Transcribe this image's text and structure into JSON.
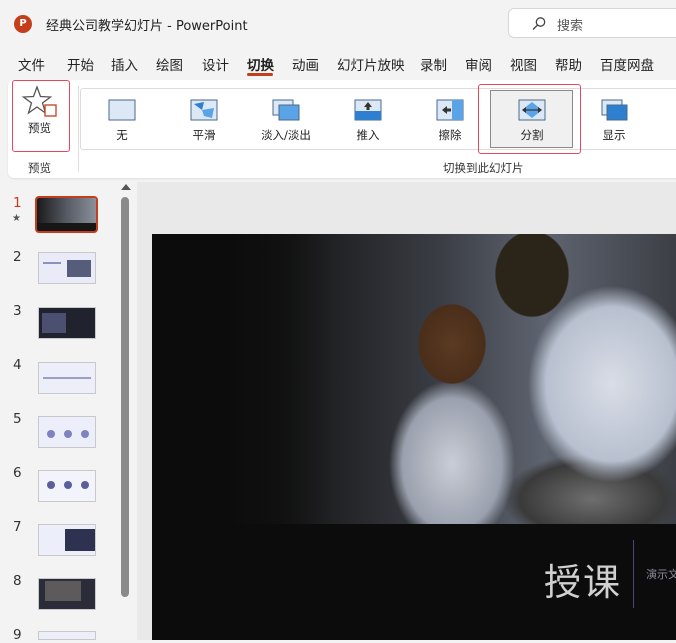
{
  "app": {
    "logo_letter": "P",
    "title": "经典公司教学幻灯片  -  PowerPoint"
  },
  "search": {
    "placeholder": "搜索"
  },
  "menu": [
    "文件",
    "开始",
    "插入",
    "绘图",
    "设计",
    "切换",
    "动画",
    "幻灯片放映",
    "录制",
    "审阅",
    "视图",
    "帮助",
    "百度网盘"
  ],
  "active_tab": "切换",
  "ribbon": {
    "preview": {
      "button_label": "预览",
      "group_label": "预览"
    },
    "transitions": {
      "items": [
        {
          "label": "无",
          "icon": "none-transition-icon"
        },
        {
          "label": "平滑",
          "icon": "morph-transition-icon"
        },
        {
          "label": "淡入/淡出",
          "icon": "fade-transition-icon"
        },
        {
          "label": "推入",
          "icon": "push-transition-icon"
        },
        {
          "label": "擦除",
          "icon": "wipe-transition-icon"
        },
        {
          "label": "分割",
          "icon": "split-transition-icon"
        },
        {
          "label": "显示",
          "icon": "reveal-transition-icon"
        }
      ],
      "selected": "分割",
      "group_label": "切换到此幻灯片"
    }
  },
  "slides": {
    "numbers": [
      "1",
      "2",
      "3",
      "4",
      "5",
      "6",
      "7",
      "8",
      "9"
    ],
    "current": "1"
  },
  "slide": {
    "title": "授课",
    "subtitle": "演示文"
  },
  "colors": {
    "accent": "#c43e1c",
    "highlight_box": "#e3485d",
    "slide_bg": "#0c0c0c"
  }
}
